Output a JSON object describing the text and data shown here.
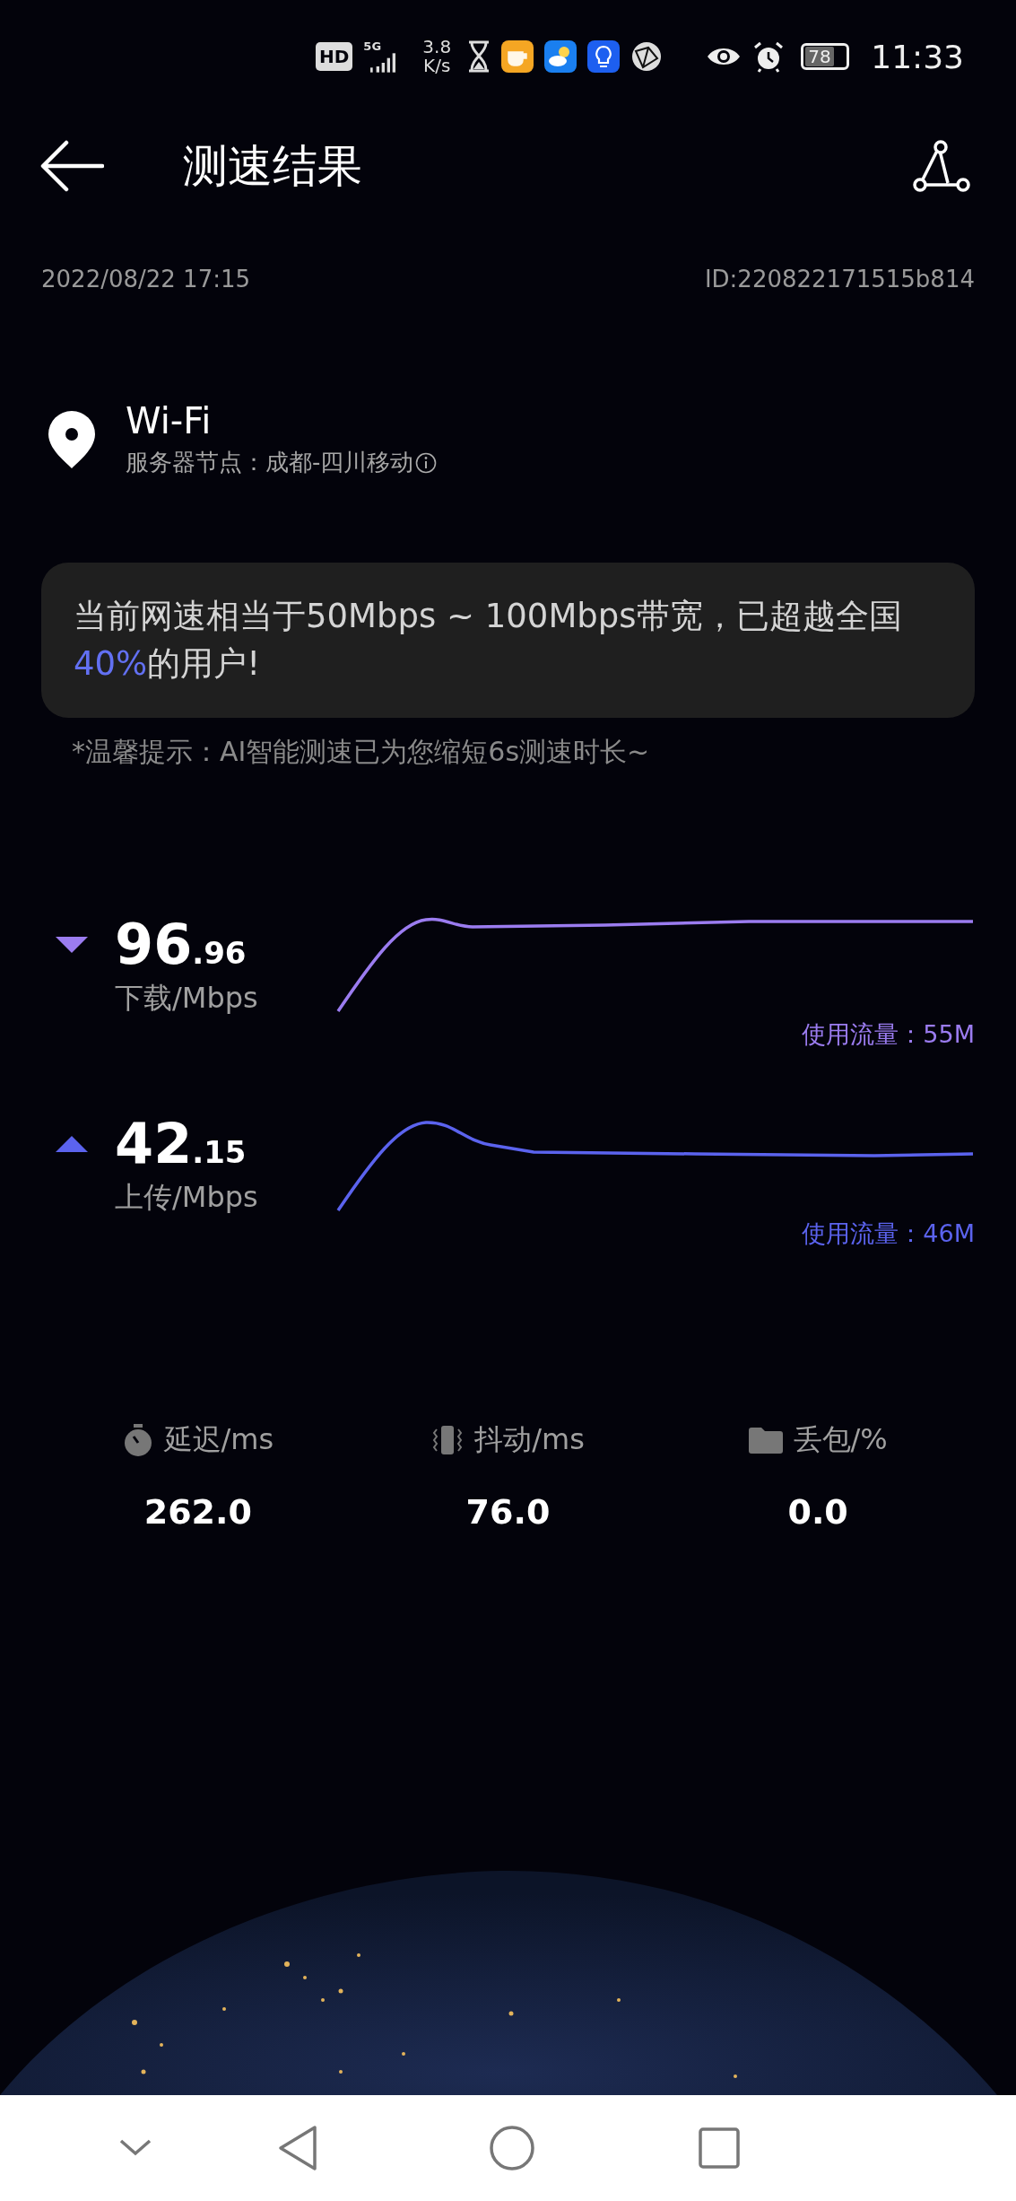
{
  "status_bar": {
    "hd_badge": "HD",
    "network": "5G",
    "speed_value": "3.8",
    "speed_unit": "K/s",
    "battery": "78",
    "time": "11:33"
  },
  "header": {
    "title": "测速结果"
  },
  "meta": {
    "date": "2022/08/22 17:15",
    "id": "ID:220822171515b814"
  },
  "location": {
    "network": "Wi-Fi",
    "server": "服务器节点：成都-四川移动"
  },
  "summary": {
    "before": "当前网速相当于50Mbps ~ 100Mbps带宽，已超越全国",
    "highlight": "40%",
    "after": "的用户!"
  },
  "tip": "*温馨提示：AI智能测速已为您缩短6s测速时长~",
  "speeds": [
    {
      "kind": "download",
      "integer": "96",
      "decimal": ".96",
      "unit": "下载/Mbps",
      "usage": "使用流量：55M",
      "color": "#9b7cf0"
    },
    {
      "kind": "upload",
      "integer": "42",
      "decimal": ".15",
      "unit": "上传/Mbps",
      "usage": "使用流量：46M",
      "color": "#5b63ee"
    }
  ],
  "stats": [
    {
      "kind": "latency",
      "label": "延迟/ms",
      "value": "262.0"
    },
    {
      "kind": "jitter",
      "label": "抖动/ms",
      "value": "76.0"
    },
    {
      "kind": "loss",
      "label": "丢包/%",
      "value": "0.0"
    }
  ]
}
